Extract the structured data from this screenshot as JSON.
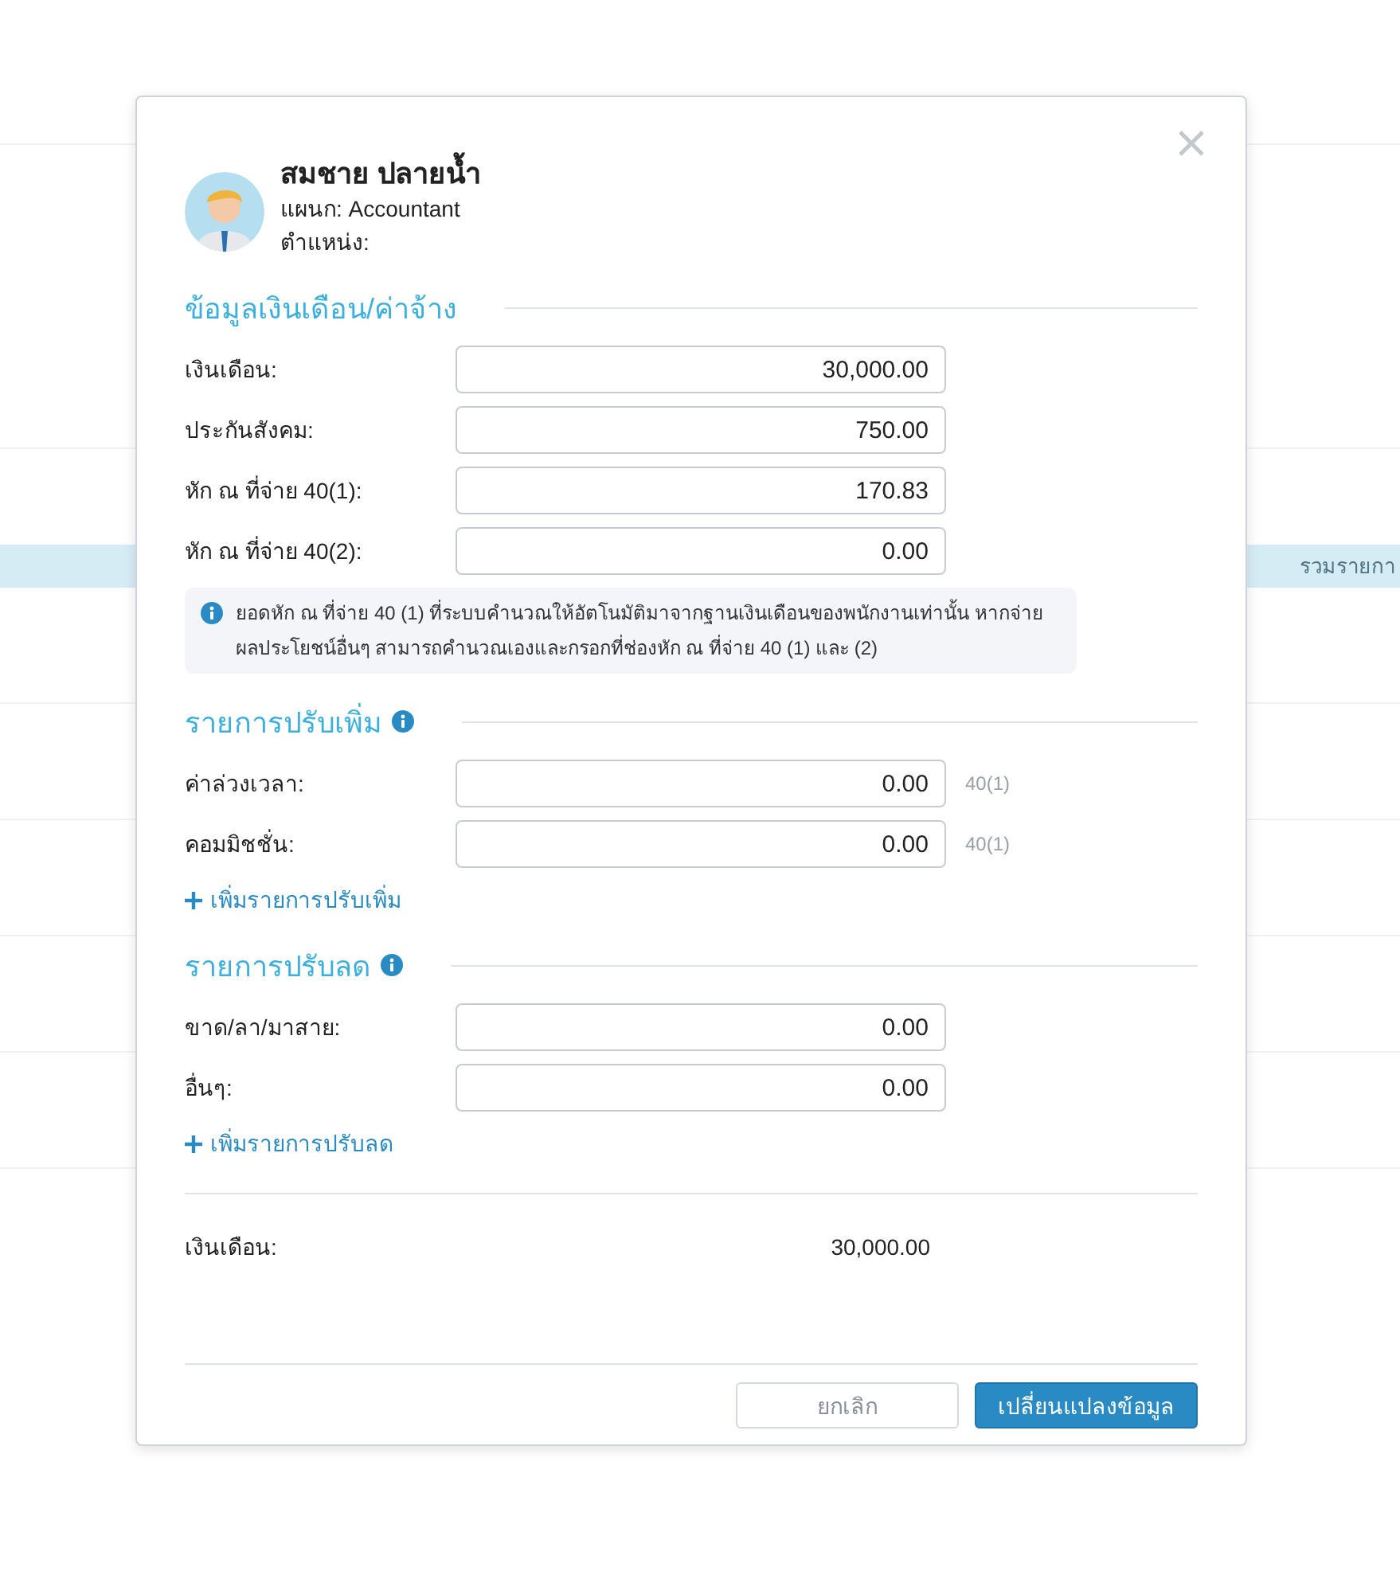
{
  "background": {
    "table_header": [
      "รวมรายกา"
    ]
  },
  "dialog": {
    "employee": {
      "name": "สมชาย ปลายน้ำ",
      "department": "แผนก: Accountant",
      "position": "ตำแหน่ง:"
    },
    "sections": [
      {
        "title": "ข้อมูลเงินเดือน/ค่าจ้าง",
        "has_info": false,
        "fields": [
          {
            "label": "เงินเดือน:",
            "value": "30,000.00"
          },
          {
            "label": "ประกันสังคม:",
            "value": "750.00"
          },
          {
            "label": "หัก ณ ที่จ่าย 40(1):",
            "value": "170.83"
          },
          {
            "label": "หัก ณ ที่จ่าย 40(2):",
            "value": "0.00"
          }
        ],
        "note": "ยอดหัก ณ ที่จ่าย 40 (1) ที่ระบบคำนวณให้อัตโนมัติมาจากฐานเงินเดือนของพนักงานเท่านั้น หากจ่ายผลประโยชน์อื่นๆ สามารถคำนวณเองและกรอกที่ช่องหัก ณ ที่จ่าย 40 (1) และ (2)"
      },
      {
        "title": "รายการปรับเพิ่ม",
        "has_info": true,
        "fields": [
          {
            "label": "ค่าล่วงเวลา:",
            "value": "0.00",
            "tag": "40(1)"
          },
          {
            "label": "คอมมิชชั่น:",
            "value": "0.00",
            "tag": "40(1)"
          }
        ],
        "add_link": "เพิ่มรายการปรับเพิ่ม"
      },
      {
        "title": "รายการปรับลด",
        "has_info": true,
        "fields": [
          {
            "label": "ขาด/ลา/มาสาย:",
            "value": "0.00"
          },
          {
            "label": "อื่นๆ:",
            "value": "0.00"
          }
        ],
        "add_link": "เพิ่มรายการปรับลด"
      }
    ],
    "summary": {
      "label": "เงินเดือน:",
      "value": "30,000.00"
    },
    "buttons": [
      {
        "label": "ยกเลิก",
        "kind": "secondary"
      },
      {
        "label": "เปลี่ยนแปลงข้อมูล",
        "kind": "primary"
      }
    ]
  }
}
